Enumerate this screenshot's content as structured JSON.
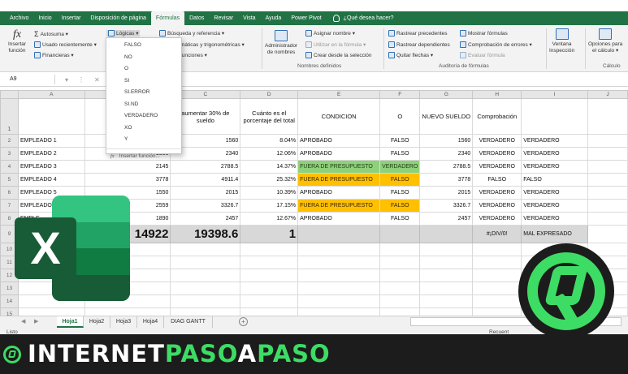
{
  "ribbon_tabs": [
    "Archivo",
    "Inicio",
    "Insertar",
    "Disposición de página",
    "Fórmulas",
    "Datos",
    "Revisar",
    "Vista",
    "Ayuda",
    "Power Pivot"
  ],
  "active_tab": "Fórmulas",
  "tell_me": "¿Qué desea hacer?",
  "ribbon": {
    "insert_function": [
      "Insertar",
      "función"
    ],
    "autosum": "Autosuma ▾",
    "recent": "Usado recientemente ▾",
    "financial": "Financieras ▾",
    "logical": "Lógicas ▾",
    "lookup": "Búsqueda y referencia ▾",
    "math": "máticas y trigonométricas ▾",
    "more": "funciones ▾",
    "name_manager": [
      "Administrador",
      "de nombres"
    ],
    "define_name": "Asignar nombre ▾",
    "use_in_formula": "Utilizar en la fórmula ▾",
    "create_from_selection": "Crear desde la selección",
    "group_defined_names": "Nombres definidos",
    "trace_precedents": "Rastrear precedentes",
    "trace_dependents": "Rastrear dependientes",
    "remove_arrows": "Quitar flechas ▾",
    "show_formulas": "Mostrar fórmulas",
    "error_checking": "Comprobación de errores ▾",
    "evaluate_formula": "Evaluar fórmula",
    "group_auditing": "Auditoría de fórmulas",
    "watch_window": [
      "Ventana",
      "Inspección"
    ],
    "calc_options": [
      "Opciones para",
      "el cálculo ▾"
    ],
    "group_calc": "Cálculo",
    "group_library_partial": "B"
  },
  "dropdown_items": [
    "FALSO",
    "NO",
    "O",
    "SI",
    "SI.ERROR",
    "SI.ND",
    "VERDADERO",
    "XO",
    "Y"
  ],
  "dropdown_insert_function": "Insertar función...",
  "formula_bar": {
    "name_box": "A9",
    "icons": [
      "▾",
      "⋮",
      "✕",
      "✓"
    ]
  },
  "columns": [
    "A",
    "B",
    "C",
    "D",
    "E",
    "F",
    "G",
    "H",
    "I",
    "J"
  ],
  "header_row": {
    "row_num": "1",
    "A": "",
    "B": "S",
    "C": "aumentar 30% de sueldo",
    "D": "Cuánto es el porcentaje del total",
    "E": "CONDICION",
    "F": "O",
    "G": "NUEVO SUELDO",
    "H": "Comprobación",
    "I": ""
  },
  "rows": [
    {
      "n": "2",
      "name": "EMPLEADO 1",
      "b": "",
      "c": "1560",
      "d": "8.04%",
      "e": "APROBADO",
      "f": "FALSO",
      "g": "1560",
      "h": "VERDADERO",
      "i": "VERDADERO",
      "e_style": "",
      "f_style": ""
    },
    {
      "n": "3",
      "name": "EMPLEADO 2",
      "b": "1800",
      "c": "2340",
      "d": "12.06%",
      "e": "APROBADO",
      "f": "FALSO",
      "g": "2340",
      "h": "VERDADERO",
      "i": "VERDADERO",
      "e_style": "",
      "f_style": ""
    },
    {
      "n": "4",
      "name": "EMPLEADO 3",
      "b": "2145",
      "c": "2788.5",
      "d": "14.37%",
      "e": "FUERA DE PRESUPUESTO",
      "f": "VERDADERO",
      "g": "2788.5",
      "h": "VERDADERO",
      "i": "VERDADERO",
      "e_style": "green",
      "f_style": "green"
    },
    {
      "n": "5",
      "name": "EMPLEADO 4",
      "b": "3778",
      "c": "4911.4",
      "d": "25.32%",
      "e": "FUERA DE PRESUPUESTO",
      "f": "FALSO",
      "g": "3778",
      "h": "FALSO",
      "i": "FALSO",
      "e_style": "orange",
      "f_style": "orange"
    },
    {
      "n": "6",
      "name": "EMPLEADO 5",
      "b": "1550",
      "c": "2015",
      "d": "10.39%",
      "e": "APROBADO",
      "f": "FALSO",
      "g": "2015",
      "h": "VERDADERO",
      "i": "VERDADERO",
      "e_style": "",
      "f_style": ""
    },
    {
      "n": "7",
      "name": "EMPLEADO 6",
      "b": "2559",
      "c": "3326.7",
      "d": "17.15%",
      "e": "FUERA DE PRESUPUESTO",
      "f": "FALSO",
      "g": "3326.7",
      "h": "VERDADERO",
      "i": "VERDADERO",
      "e_style": "orange",
      "f_style": "orange"
    },
    {
      "n": "8",
      "name": "EMPLE",
      "b": "1890",
      "c": "2457",
      "d": "12.67%",
      "e": "APROBADO",
      "f": "FALSO",
      "g": "2457",
      "h": "VERDADERO",
      "i": "VERDADERO",
      "e_style": "",
      "f_style": ""
    }
  ],
  "total_row": {
    "n": "9",
    "b": "14922",
    "c": "19398.6",
    "d": "1",
    "h": "#¡DIV/0!",
    "i": "MAL EXPRESADO"
  },
  "empty_rows": [
    "10",
    "11",
    "12",
    "13",
    "14",
    "15",
    "16"
  ],
  "sheet_tabs": [
    "Hoja1",
    "Hoja2",
    "Hoja3",
    "Hoja4",
    "DIAG GANTT"
  ],
  "active_sheet": "Hoja1",
  "status_left": "Listo",
  "status_right": "Recuent",
  "banner": {
    "part1": "INTERNET",
    "part2": "PASO",
    "part3": "A",
    "part4": "PASO"
  },
  "colors": {
    "excel_green": "#217346",
    "ok_green": "#8fd07a",
    "warn_orange": "#ffc000",
    "brand_green": "#3ddc64"
  }
}
